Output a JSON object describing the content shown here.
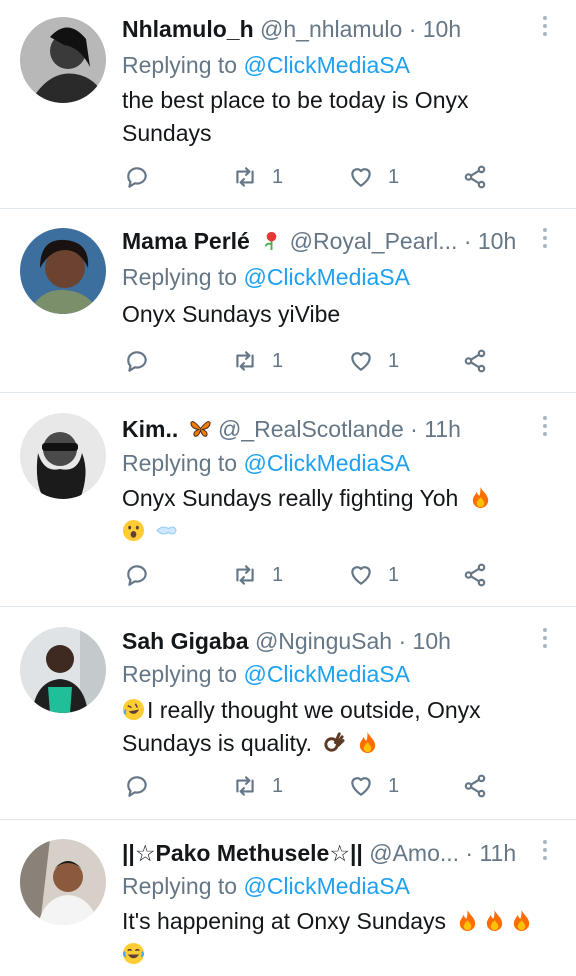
{
  "colors": {
    "accent": "#1da1f2",
    "secondary_text": "#657786",
    "separator": "#e1e8ed"
  },
  "tweets": [
    {
      "name": "Nhlamulo_h",
      "handle": "@h_nhlamulo",
      "time": "· 10h",
      "reply_prefix": "Replying to",
      "reply_to": "@ClickMediaSA",
      "text_line1": "the best place to be today is Onyx",
      "text_line2": "Sundays",
      "retweets": "1",
      "likes": "1"
    },
    {
      "name": "Mama Perlé",
      "handle": "@Royal_Pearl...",
      "time": "· 10h",
      "reply_prefix": "Replying to",
      "reply_to": "@ClickMediaSA",
      "text_line1": "Onyx Sundays yiVibe",
      "retweets": "1",
      "likes": "1",
      "badge_icon": "rose-icon"
    },
    {
      "name": "Kim..",
      "handle": "@_RealScotlande",
      "time": "· 11h",
      "reply_prefix": "Replying to",
      "reply_to": "@ClickMediaSA",
      "text_line1": "Onyx Sundays really fighting Yoh",
      "retweets": "1",
      "likes": "1",
      "badge_icon": "butterfly-icon"
    },
    {
      "name": "Sah Gigaba",
      "handle": "@NginguSah",
      "time": "· 10h",
      "reply_prefix": "Replying to",
      "reply_to": "@ClickMediaSA",
      "text_line1": "I really thought we outside, Onyx",
      "text_line2": "Sundays is quality.",
      "retweets": "1",
      "likes": "1"
    },
    {
      "name": "||☆Pako Methusele☆||",
      "handle": "@Amo...",
      "time": "· 11h",
      "reply_prefix": "Replying to",
      "reply_to": "@ClickMediaSA",
      "text_line1": "It's happening at Onxy Sundays"
    }
  ],
  "icons": [
    "reply-icon",
    "retweet-icon",
    "like-icon",
    "share-icon",
    "more-options-icon"
  ]
}
